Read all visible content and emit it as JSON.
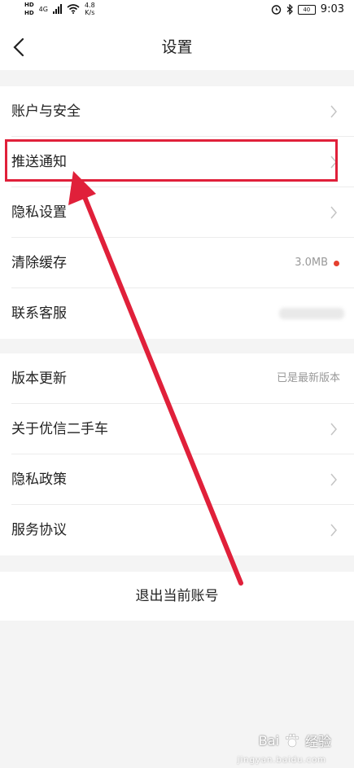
{
  "status_bar": {
    "network_speed": "4.8",
    "network_speed_unit": "K/s",
    "time": "9:03",
    "battery": "40",
    "sim1": "HD",
    "sim2": "HD",
    "net_type": "4G"
  },
  "navbar": {
    "title": "设置",
    "back_icon": "chevron-left-icon"
  },
  "group1": {
    "items": [
      {
        "label": "账户与安全"
      },
      {
        "label": "推送通知"
      },
      {
        "label": "隐私设置"
      },
      {
        "label": "清除缓存",
        "value": "3.0MB"
      },
      {
        "label": "联系客服"
      }
    ]
  },
  "group2": {
    "items": [
      {
        "label": "版本更新",
        "value": "已是最新版本"
      },
      {
        "label": "关于优信二手车"
      },
      {
        "label": "隐私政策"
      },
      {
        "label": "服务协议"
      }
    ]
  },
  "logout_label": "退出当前账号",
  "watermark": {
    "brand": "Bai",
    "brand2": "经验",
    "sub": "jingyan.baidu.com"
  },
  "colors": {
    "highlight": "#e0203a",
    "dot": "#e5402f",
    "background": "#f4f4f4"
  }
}
